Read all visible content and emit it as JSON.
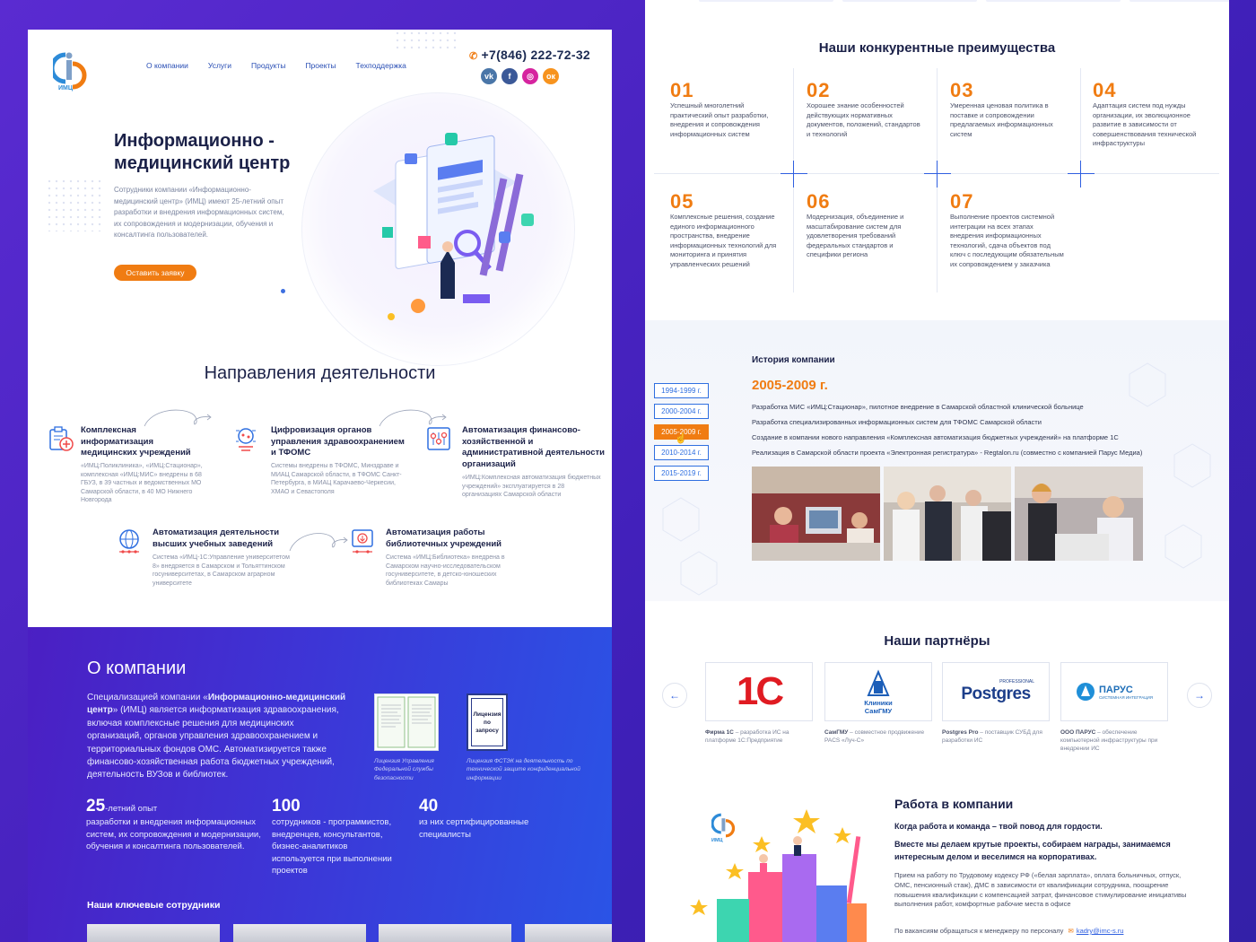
{
  "header": {
    "logo_text": "ИМЦ",
    "nav": [
      "О компании",
      "Услуги",
      "Продукты",
      "Проекты",
      "Техподдержка"
    ],
    "phone": "+7(846) 222-72-32",
    "socials": [
      "vk-icon",
      "facebook-icon",
      "instagram-icon",
      "odnoklassniki-icon"
    ]
  },
  "hero": {
    "title_line1": "Информационно -",
    "title_line2": "медицинский центр",
    "text": "Сотрудники компании «Информационно-медицинский центр» (ИМЦ) имеют 25-летний опыт разработки и внедрения информационных систем, их сопровождения и модернизации, обучения и консалтинга пользователей.",
    "button": "Оставить заявку"
  },
  "directions": {
    "title": "Направления деятельности",
    "items": [
      {
        "title": "Комплексная информатизация медицинских учреждений",
        "text": "«ИМЦ:Поликлиника», «ИМЦ:Стационар», комплексная «ИМЦ:МИС» внедрены в 68 ГБУЗ, в 39 частных и ведомственных МО Самарской области, в 40 МО Нижнего Новгорода"
      },
      {
        "title": "Цифровизация органов управления здравоохранением и ТФОМС",
        "text": "Системы внедрены в ТФОМС, Минздраве и МИАЦ Самарской области, в ТФОМС Санкт-Петербурга, в МИАЦ Карачаево-Черкесии, ХМАО и Севастополя"
      },
      {
        "title": "Автоматизация финансово-хозяйственной и административной деятельности организаций",
        "text": "«ИМЦ:Комплексная автоматизация бюджетных учреждений» эксплуатируется в 28 организациях Самарской области"
      },
      {
        "title": "Автоматизация деятельности высших учебных заведений",
        "text": "Система «ИМЦ-1С:Управление университетом 8» внедряется в Самарском и Тольяттинском госуниверситетах, в Самарском аграрном университете"
      },
      {
        "title": "Автоматизация работы библиотечных учреждений",
        "text": "Система «ИМЦ:Библиотека» внедрена в Самарском научно-исследовательском госуниверситете, в детско-юношеских библиотеках Самары"
      }
    ]
  },
  "about": {
    "title": "О компании",
    "text_pre": "Специализацией компании «",
    "text_bold": "Информационно-медицинский центр",
    "text_post": "» (ИМЦ) является информатизация здравоохранения, включая комплексные решения для медицинских организаций, органов управления здравоохранением и территориальных фондов ОМС. Автоматизируется также финансово-хозяйственная работа бюджетных учреждений, деятельность ВУЗов и библиотек.",
    "license1_caption": "Лицензия Управления Федеральной службы безопасности",
    "license2_label": "Лицензия по запросу",
    "license2_caption": "Лицензия ФСТЭК на деятельность по технической защите конфиденциальной информации",
    "stats": [
      {
        "num": "25",
        "suffix": "-летний опыт",
        "text": "разработки и внедрения информационных систем, их сопровождения и модернизации, обучения и консалтинга пользователей."
      },
      {
        "num": "100",
        "suffix": "",
        "text": "сотрудников - программистов, внедренцев, консультантов, бизнес-аналитиков используется при выполнении проектов"
      },
      {
        "num": "40",
        "suffix": "",
        "text": "из них сертифицированные специалисты"
      }
    ],
    "staff_title": "Наши ключевые сотрудники"
  },
  "advantages": {
    "title": "Наши конкурентные преимущества",
    "items": [
      {
        "num": "01",
        "text": "Успешный многолетний практический опыт разработки, внедрения и сопровождения информационных систем"
      },
      {
        "num": "02",
        "text": "Хорошее знание особенностей действующих нормативных документов, положений, стандартов и технологий"
      },
      {
        "num": "03",
        "text": "Умеренная ценовая политика в поставке и сопровождении предлагаемых информационных систем"
      },
      {
        "num": "04",
        "text": "Адаптация систем под нужды организации, их эволюционное развитие в зависимости от совершенствования технической инфраструктуры"
      },
      {
        "num": "05",
        "text": "Комплексные решения, создание единого информационного пространства, внедрение информационных технологий для мониторинга и принятия управленческих решений"
      },
      {
        "num": "06",
        "text": "Модернизация, объединение и масштабирование систем для удовлетворения требований федеральных стандартов и специфики региона"
      },
      {
        "num": "07",
        "text": "Выполнение проектов системной интеграции на всех этапах внедрения информационных технологий, сдача объектов под ключ с последующим обязательным их сопровождением у заказчика"
      }
    ]
  },
  "history": {
    "title": "История компании",
    "years": [
      "1994-1999 г.",
      "2000-2004 г.",
      "2005-2009 г.",
      "2010-2014 г.",
      "2015-2019 г."
    ],
    "active_index": 2,
    "active_year": "2005-2009 г.",
    "items": [
      "Разработка МИС «ИМЦ:Стационар», пилотное внедрение в Самарской областной клинической больнице",
      "Разработка специализированных информационных систем для ТФОМС Самарской области",
      "Создание в компании нового направления «Комплексная автоматизация бюджетных учреждений» на платформе 1С",
      "Реализация в Самарской области проекта «Электронная регистратура» - Regtalon.ru (совместно с компанией Парус Медиа)"
    ]
  },
  "partners": {
    "title": "Наши партнёры",
    "items": [
      {
        "logo": "1С",
        "name": "Фирма 1С",
        "text": " – разработка ИС на платформе 1С:Предприятие"
      },
      {
        "logo": "Клиники СамГМУ",
        "name": "СамГМУ",
        "text": " – совместное продвижение PACS «Луч-С»"
      },
      {
        "logo": "Postgres",
        "logo_small": "PROFESSIONAL",
        "name": "Postgres Pro",
        "text": " – поставщик СУБД для разработки ИС"
      },
      {
        "logo": "ПАРУС",
        "logo_small": "СИСТЕМНАЯ ИНТЕГРАЦИЯ",
        "name": "ООО ПАРУС",
        "text": " – обеспечение компьютерной инфраструктуры при внедрении ИС"
      }
    ]
  },
  "work": {
    "title": "Работа в компании",
    "bold1": "Когда работа и команда – твой повод для гордости.",
    "bold2": "Вместе мы делаем крутые проекты, собираем награды, занимаемся интересным делом и веселимся на корпоративах.",
    "text": "Прием на работу по Трудовому кодексу РФ («белая зарплата», оплата больничных, отпуск, ОМС, пенсионный стаж), ДМС в зависимости от квалификации сотрудника, поощрение повышения квалификации с компенсацией затрат, финансовое стимулирование инициативы выполнения работ, комфортные рабочие места в офисе",
    "contact": "По вакансиям обращаться к менеджеру по персоналу",
    "email": "kadry@imc-s.ru",
    "logo_text": "ИМЦ"
  },
  "colors": {
    "accent": "#f07c12",
    "brand_blue": "#2f5fe0",
    "dark": "#1b2148",
    "bg_purple": "#4a21c4"
  }
}
